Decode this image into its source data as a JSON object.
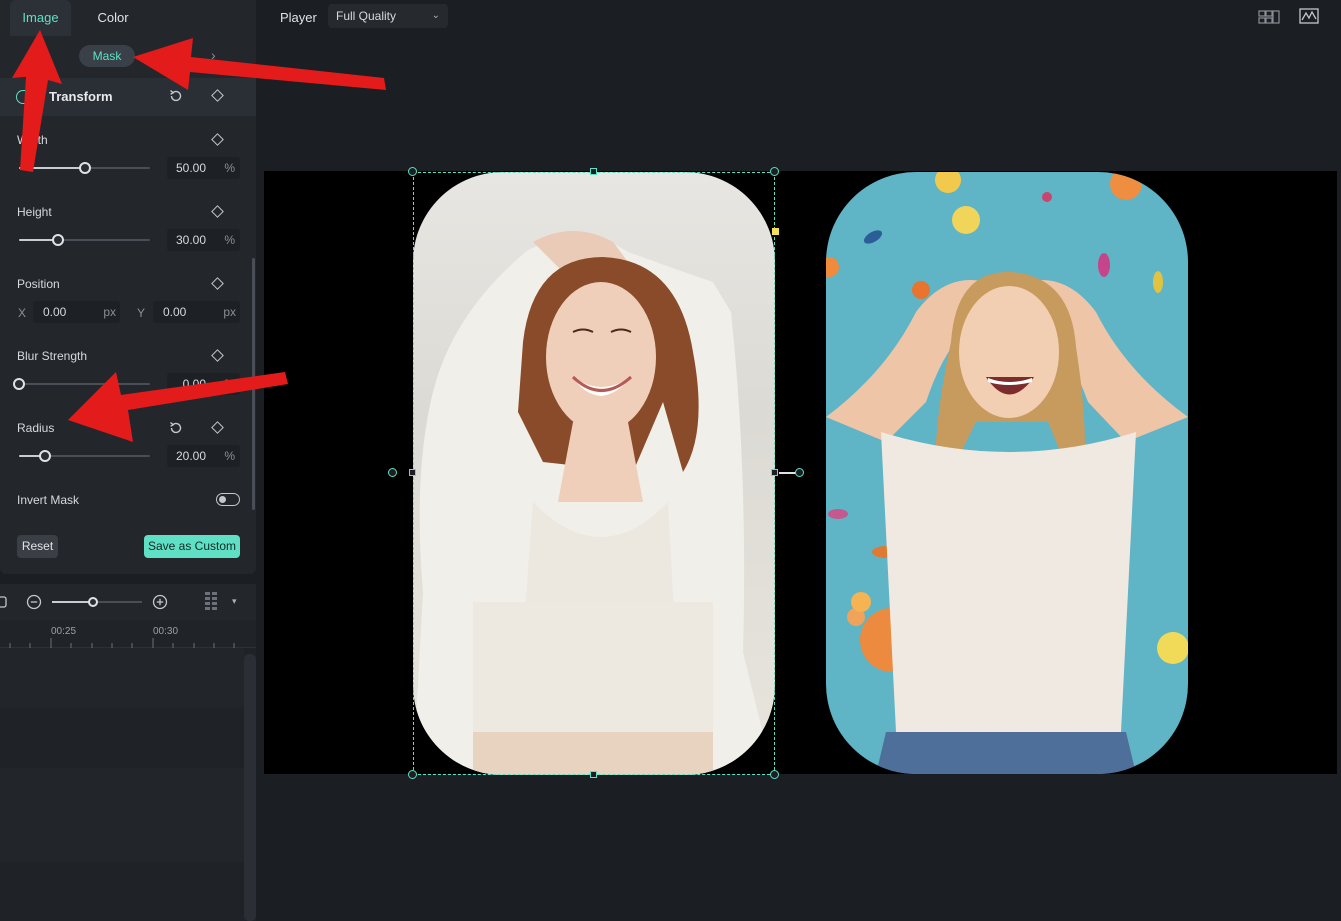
{
  "tabs": {
    "image": "Image",
    "color": "Color"
  },
  "subtabs": {
    "previous_partial": "c",
    "mask": "Mask"
  },
  "section": {
    "title": "Transform"
  },
  "width": {
    "label": "Width",
    "value": "50.00",
    "unit": "%",
    "level": 0.5
  },
  "height": {
    "label": "Height",
    "value": "30.00",
    "unit": "%",
    "level": 0.3
  },
  "position": {
    "label": "Position",
    "x_label": "X",
    "x_value": "0.00",
    "y_label": "Y",
    "y_value": "0.00",
    "unit": "px"
  },
  "blur": {
    "label": "Blur Strength",
    "value": "0.00",
    "unit": "%",
    "level": 0.0
  },
  "radius": {
    "label": "Radius",
    "value": "20.00",
    "unit": "%",
    "level": 0.2
  },
  "invert_mask": {
    "label": "Invert Mask",
    "on": false
  },
  "buttons": {
    "reset": "Reset",
    "save_custom": "Save as Custom"
  },
  "timeline": {
    "ticks": [
      "00:25",
      "00:30"
    ],
    "zoom_level": 0.45
  },
  "player": {
    "label": "Player",
    "quality": "Full Quality"
  },
  "colors": {
    "accent": "#5fe0c4",
    "annotation_arrow": "#e31b1b"
  },
  "images": [
    {
      "name": "woman-brown-hair-white-shirt",
      "selected": true
    },
    {
      "name": "woman-blonde-confetti-blue-bg",
      "selected": false
    }
  ]
}
